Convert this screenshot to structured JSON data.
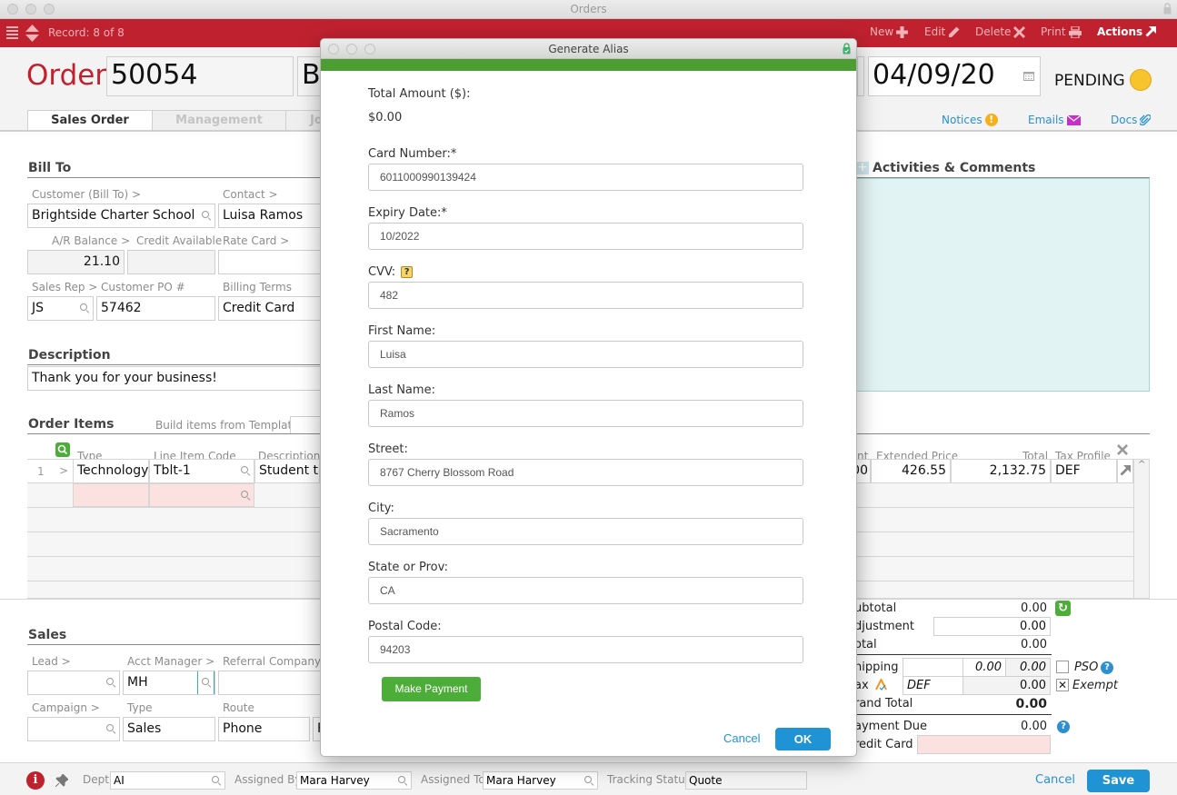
{
  "window": {
    "title": "Orders"
  },
  "toolbar": {
    "record": "Record: 8 of 8",
    "new": "New",
    "edit": "Edit",
    "delete": "Delete",
    "print": "Print",
    "actions": "Actions"
  },
  "header": {
    "order_label": "Order:",
    "order_number": "50054",
    "customer_partial": "B",
    "date": "04/09/20",
    "status": "PENDING",
    "status_color": "#f8c42d",
    "tabs": [
      {
        "label": "Sales Order",
        "active": true
      },
      {
        "label": "Management",
        "active": false
      },
      {
        "label": "Jo",
        "active": false
      }
    ],
    "links": {
      "notices": "Notices",
      "emails": "Emails",
      "docs": "Docs"
    }
  },
  "bill_to": {
    "title": "Bill To",
    "customer_label": "Customer (Bill To) >",
    "customer": "Brightside Charter School",
    "contact_label": "Contact >",
    "contact": "Luisa Ramos",
    "ar_balance_label": "A/R Balance >",
    "ar_balance": "21.10",
    "credit_available_label": "Credit Available",
    "credit_available": "",
    "rate_card_label": "Rate Card >",
    "rate_card": "",
    "sales_rep_label": "Sales Rep >",
    "sales_rep": "JS",
    "customer_po_label": "Customer PO #",
    "customer_po": "57462",
    "billing_terms_label": "Billing Terms",
    "billing_terms": "Credit Card"
  },
  "description": {
    "title": "Description",
    "value": "Thank you for your business!"
  },
  "activities": {
    "title": "Activities & Comments"
  },
  "order_items": {
    "title": "Order Items",
    "template_label": "Build items from Template:",
    "columns": {
      "type": "Type",
      "line_item_code": "Line Item Code",
      "description": "Description",
      "amount_partial": "nt",
      "extended_price": "Extended Price",
      "total": "Total",
      "tax_profile": "Tax Profile"
    },
    "rows": [
      {
        "num": "1",
        "arrow": ">",
        "type": "Technology",
        "code": "Tblt-1",
        "description": "Student tab",
        "amount_partial": "00",
        "extended_price": "426.55",
        "total": "2,132.75",
        "tax_profile": "DEF"
      }
    ]
  },
  "totals": {
    "subtotal_label": "ubtotal",
    "subtotal": "0.00",
    "adjustment_label": "djustment",
    "adjustment": "0.00",
    "total_label": "otal",
    "total": "0.00",
    "shipping_label": "hipping",
    "shipping_a": "0.00",
    "shipping_b": "0.00",
    "pso_label": "PSO",
    "tax_label": "ax",
    "tax_profile": "DEF",
    "tax": "0.00",
    "exempt_label": "Exempt",
    "exempt_checked": true,
    "grand_total_label": "rand Total",
    "grand_total": "0.00",
    "payment_due_label": "ayment Due",
    "payment_due": "0.00",
    "credit_card_label": "redit Card"
  },
  "sales": {
    "title": "Sales",
    "lead_label": "Lead >",
    "lead": "",
    "acct_manager_label": "Acct Manager >",
    "acct_manager": "MH",
    "referral_label": "Referral Company >",
    "referral": "",
    "campaign_label": "Campaign >",
    "campaign": "",
    "type_label": "Type",
    "type": "Sales",
    "route_label": "Route",
    "route": "Phone",
    "extra_partial": "F"
  },
  "footer": {
    "dept_label": "Dept",
    "dept": "AI",
    "assigned_by_label": "Assigned By",
    "assigned_by": "Mara Harvey",
    "assigned_to_label": "Assigned To",
    "assigned_to": "Mara Harvey",
    "tracking_label": "Tracking Status",
    "tracking": "Quote",
    "cancel": "Cancel",
    "save": "Save"
  },
  "dialog": {
    "title": "Generate Alias",
    "total_amount_label": "Total Amount ($):",
    "total_amount": "$0.00",
    "fields": [
      {
        "label": "Card Number:*",
        "value": "6011000990139424"
      },
      {
        "label": "Expiry Date:*",
        "value": "10/2022"
      },
      {
        "label": "CVV:",
        "value": "482"
      },
      {
        "label": "First Name:",
        "value": "Luisa"
      },
      {
        "label": "Last Name:",
        "value": "Ramos"
      },
      {
        "label": "Street:",
        "value": "8767 Cherry Blossom Road"
      },
      {
        "label": "City:",
        "value": "Sacramento"
      },
      {
        "label": "State or Prov:",
        "value": "CA"
      },
      {
        "label": "Postal Code:",
        "value": "94203"
      }
    ],
    "make_payment": "Make Payment",
    "cancel": "Cancel",
    "ok": "OK"
  }
}
